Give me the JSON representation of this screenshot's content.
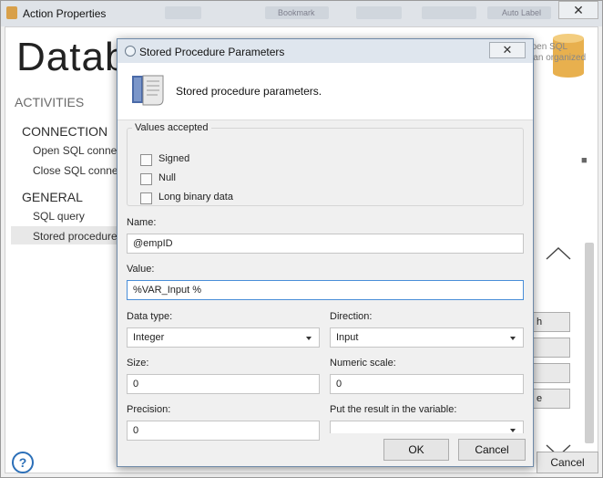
{
  "outer": {
    "title": "Action Properties",
    "big_title": "Datab",
    "activities_label": "ACTIVITIES",
    "connection_group": "CONNECTION",
    "connection_items": [
      "Open SQL connectio",
      "Close SQL connectio"
    ],
    "general_group": "GENERAL",
    "general_items": [
      "SQL query",
      "Stored procedure"
    ],
    "selected_item": "Stored procedure",
    "bg_desc_line1": "action activities such as Open SQL Connection, SQL que",
    "bg_desc_line2": "e database. A database is an organized collection of data.",
    "ribbon_bookmark": "Bookmark",
    "ribbon_autolabel": "Auto Label",
    "side_buttons": [
      "h",
      "",
      "",
      "e"
    ],
    "cancel_label": "Cancel",
    "help_label": "?"
  },
  "dialog": {
    "title": "Stored Procedure Parameters",
    "close_label": "✕",
    "header_text": "Stored procedure parameters.",
    "values_accepted": {
      "legend": "Values accepted",
      "options": [
        {
          "label": "Signed",
          "checked": false
        },
        {
          "label": "Null",
          "checked": false
        },
        {
          "label": "Long binary data",
          "checked": false
        }
      ]
    },
    "name": {
      "label": "Name:",
      "value": "@empID"
    },
    "value": {
      "label": "Value:",
      "value": "%VAR_Input %"
    },
    "data_type": {
      "label": "Data type:",
      "selected": "Integer"
    },
    "direction": {
      "label": "Direction:",
      "selected": "Input"
    },
    "size": {
      "label": "Size:",
      "value": "0"
    },
    "numeric_scale": {
      "label": "Numeric scale:",
      "value": "0"
    },
    "precision": {
      "label": "Precision:",
      "value": "0"
    },
    "result_variable": {
      "label": "Put the result in the variable:",
      "selected": ""
    },
    "ok_label": "OK",
    "cancel_label": "Cancel"
  },
  "colors": {
    "focus_border": "#4a8ed8",
    "db_icon": "#e8b04e",
    "help_blue": "#2b6fb8"
  }
}
